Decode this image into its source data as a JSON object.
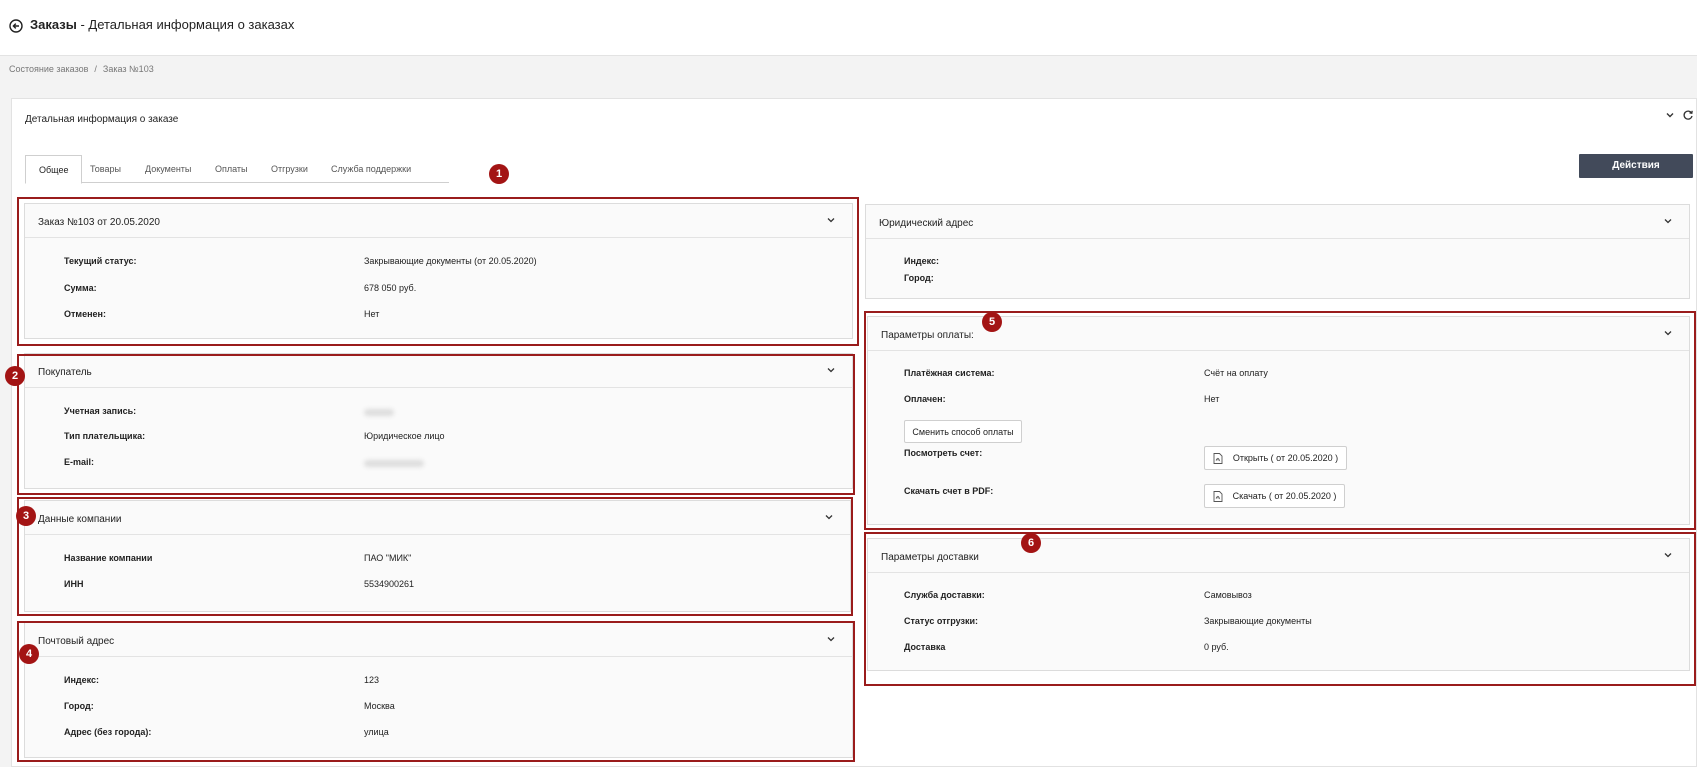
{
  "header": {
    "title_bold": "Заказы",
    "title_rest": " - Детальная информация о заказах"
  },
  "breadcrumb": {
    "items": [
      "Состояние заказов",
      "Заказ №103"
    ],
    "separator": "/"
  },
  "panel": {
    "title": "Детальная информация о заказе"
  },
  "tabs": [
    {
      "label": "Общее",
      "active": true
    },
    {
      "label": "Товары"
    },
    {
      "label": "Документы"
    },
    {
      "label": "Оплаты"
    },
    {
      "label": "Отгрузки"
    },
    {
      "label": "Служба поддержки"
    }
  ],
  "actions_label": "Действия",
  "order_card": {
    "title": "Заказ №103 от 20.05.2020",
    "rows": [
      {
        "label": "Текущий статус:",
        "value": "Закрывающие документы (от 20.05.2020)"
      },
      {
        "label": "Сумма:",
        "value": "678 050 руб."
      },
      {
        "label": "Отменен:",
        "value": "Нет"
      }
    ]
  },
  "buyer_card": {
    "title": "Покупатель",
    "rows": [
      {
        "label": "Учетная запись:"
      },
      {
        "label": "Тип плательщика:",
        "value": "Юридическое лицо"
      },
      {
        "label": "E-mail:"
      }
    ]
  },
  "company_card": {
    "title": "Данные компании",
    "rows": [
      {
        "label": "Название компании",
        "value": "ПАО \"МИК\""
      },
      {
        "label": "ИНН",
        "value": "5534900261"
      }
    ]
  },
  "postal_card": {
    "title": "Почтовый адрес",
    "rows": [
      {
        "label": "Индекс:",
        "value": "123"
      },
      {
        "label": "Город:",
        "value": "Москва"
      },
      {
        "label": "Адрес (без города):",
        "value": "улица"
      }
    ]
  },
  "legal_card": {
    "title": "Юридический адрес",
    "rows": [
      {
        "label": "Индекс:"
      },
      {
        "label": "Город:"
      }
    ]
  },
  "payment_card": {
    "title": "Параметры оплаты:",
    "rows": [
      {
        "label": "Платёжная система:",
        "value": "Счёт на оплату"
      },
      {
        "label": "Оплачен:",
        "value": "Нет"
      },
      {
        "label": "Посмотреть счет:"
      },
      {
        "label": "Скачать счет в PDF:"
      }
    ],
    "change_btn": "Сменить способ оплаты",
    "open_btn": "Открыть ( от 20.05.2020 )",
    "download_btn": "Скачать ( от 20.05.2020 )"
  },
  "delivery_card": {
    "title": "Параметры доставки",
    "rows": [
      {
        "label": "Служба доставки:",
        "value": "Самовывоз"
      },
      {
        "label": "Статус отгрузки:",
        "value": "Закрывающие документы"
      },
      {
        "label": "Доставка",
        "value": "0 руб."
      }
    ]
  },
  "badges": [
    "1",
    "2",
    "3",
    "4",
    "5",
    "6"
  ],
  "colors": {
    "accent_red": "#9a1c1c",
    "badge_red": "#a31414",
    "actions_bg": "#424a5a"
  }
}
